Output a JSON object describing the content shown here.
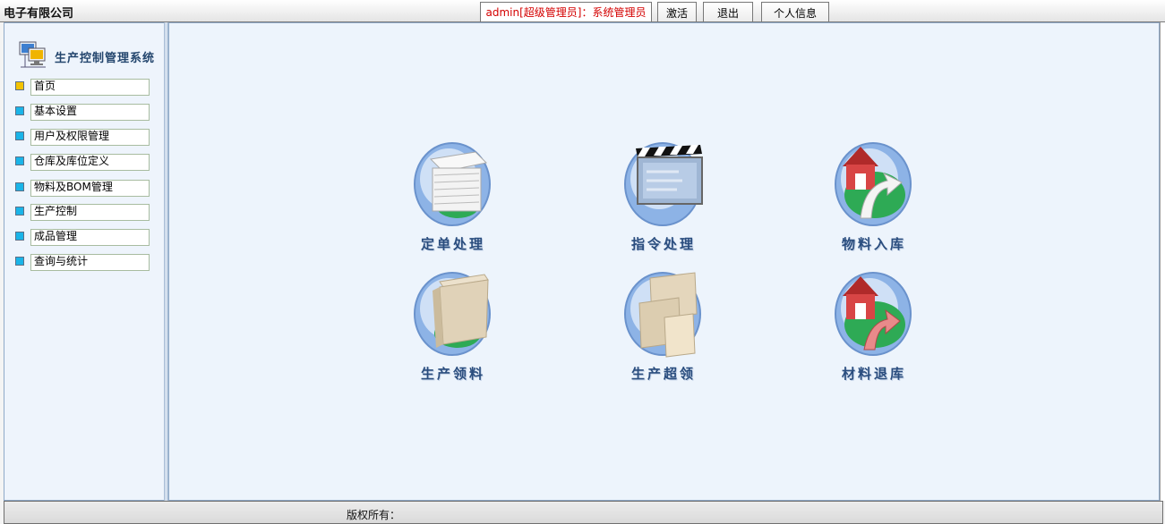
{
  "header": {
    "company": "电子有限公司",
    "user_info": "admin[超级管理员]：系统管理员",
    "buttons": {
      "activate": "激活",
      "logout": "退出",
      "profile": "个人信息"
    }
  },
  "sidebar": {
    "system_title": "生产控制管理系统",
    "system_icon": "computer-network-icon",
    "items": [
      {
        "label": "首页",
        "active": true
      },
      {
        "label": "基本设置"
      },
      {
        "label": "用户及权限管理"
      },
      {
        "label": "仓库及库位定义"
      },
      {
        "label": "物料及BOM管理"
      },
      {
        "label": "生产控制"
      },
      {
        "label": "成品管理"
      },
      {
        "label": "查询与统计"
      }
    ]
  },
  "main": {
    "tiles": [
      {
        "label": "定单处理",
        "icon": "paper-stack-icon"
      },
      {
        "label": "指令处理",
        "icon": "clapperboard-icon"
      },
      {
        "label": "物料入库",
        "icon": "warehouse-in-icon"
      },
      {
        "label": "生产领料",
        "icon": "box-icon"
      },
      {
        "label": "生产超领",
        "icon": "boxes-icon"
      },
      {
        "label": "材料退库",
        "icon": "warehouse-return-icon"
      }
    ]
  },
  "footer": {
    "copyright": "版权所有："
  },
  "colors": {
    "user_info_text": "#d40000",
    "menu_bullet": "#1ab4e8",
    "menu_bullet_active": "#f2c200",
    "tile_label": "#2a4d7e",
    "main_background": "#edf4fc"
  }
}
